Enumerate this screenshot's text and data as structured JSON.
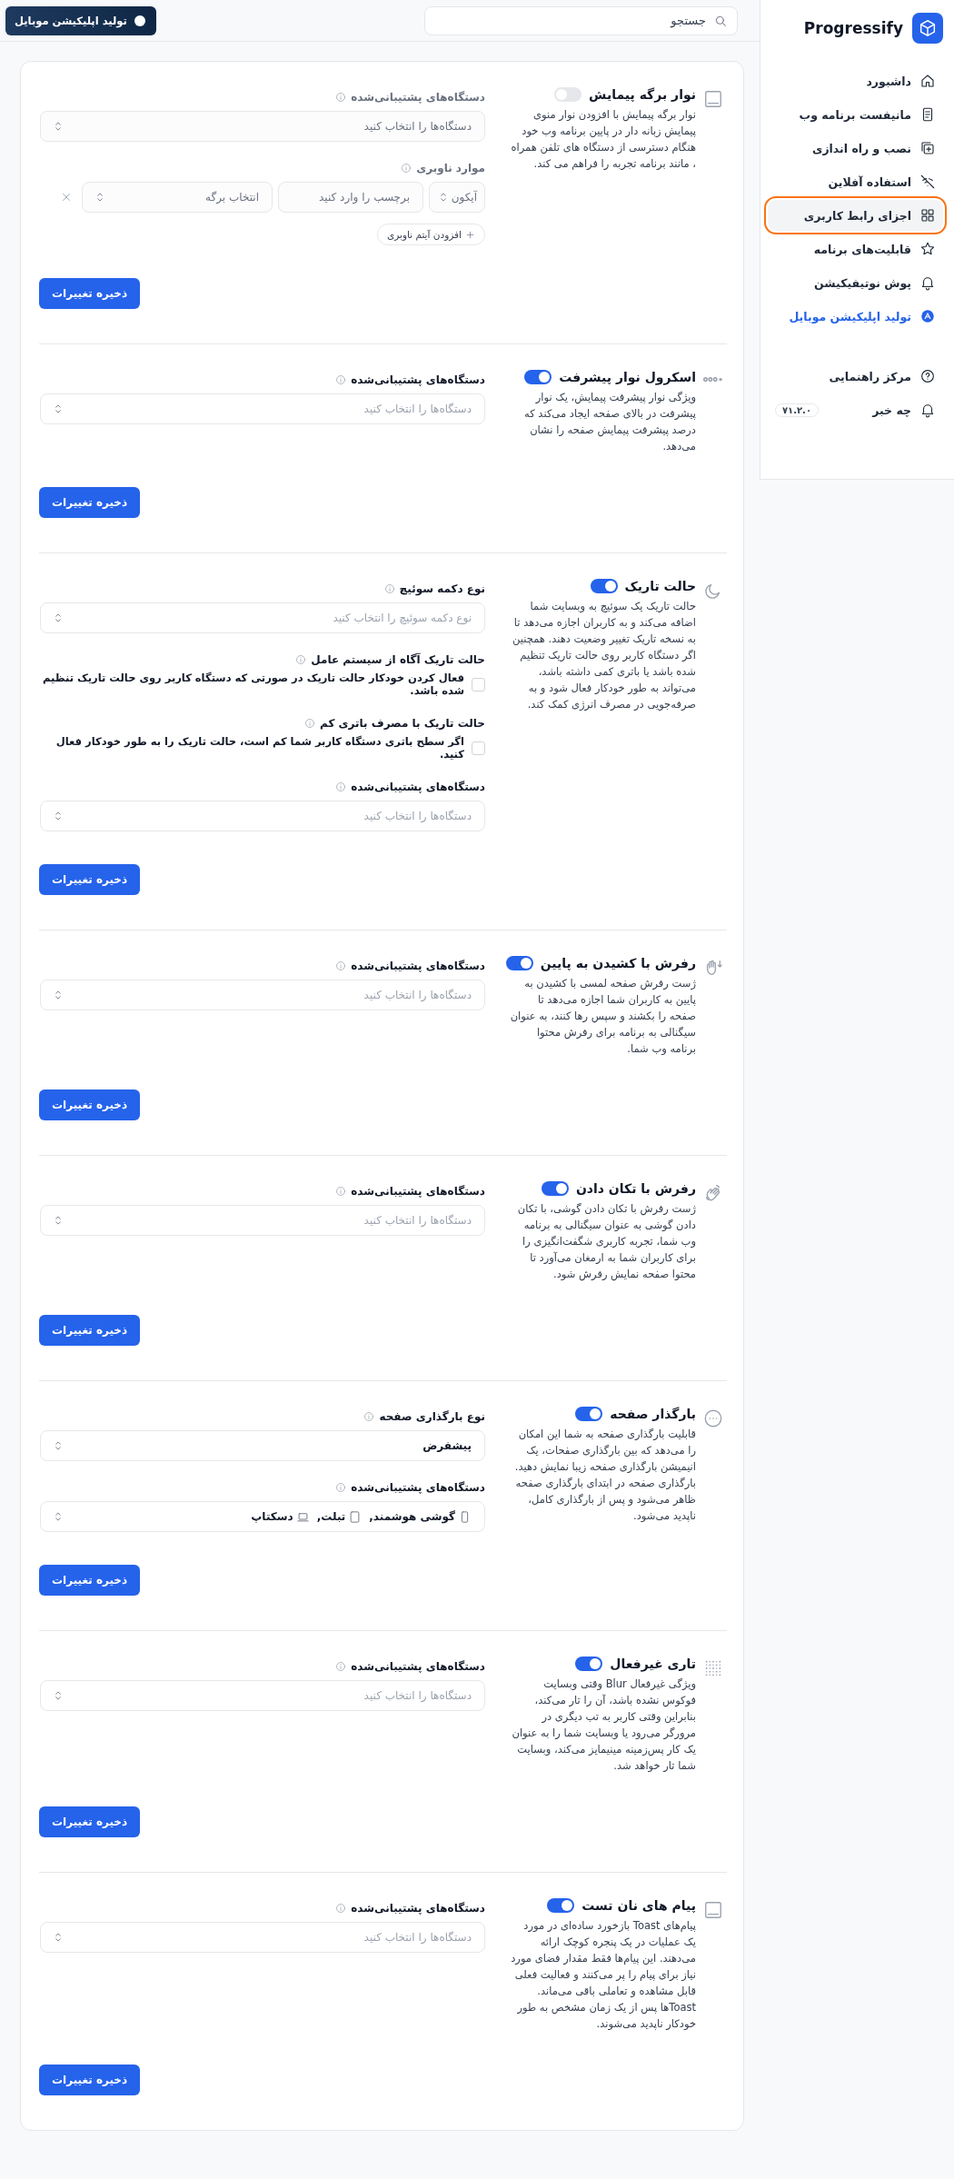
{
  "sidebar": {
    "brand": "Progressify",
    "items": [
      {
        "label": "داشبورد",
        "selected": false,
        "accent": false
      },
      {
        "label": "مانیفست برنامه وب",
        "selected": false,
        "accent": false
      },
      {
        "label": "نصب و راه اندازی",
        "selected": false,
        "accent": false
      },
      {
        "label": "استفاده آفلاین",
        "selected": false,
        "accent": false
      },
      {
        "label": "اجزای رابط کاربری",
        "selected": true,
        "accent": false
      },
      {
        "label": "قابلیت‌های برنامه",
        "selected": false,
        "accent": false
      },
      {
        "label": "پوش نوتیفیکیشن",
        "selected": false,
        "accent": false
      },
      {
        "label": "تولید اپلیکیشن موبایل",
        "selected": false,
        "accent": true
      }
    ],
    "footer": [
      {
        "label": "مرکز راهنمایی"
      },
      {
        "label": "چه خبر",
        "badge": "۷۱.۲.۰"
      }
    ]
  },
  "topbar": {
    "search": {
      "placeholder": "جستجو"
    },
    "button": "تولید اپلیکیشن موبایل"
  },
  "sections": [
    {
      "title": "نوار برگه پیمایش",
      "on": false,
      "description": "نوار برگه پیمایش با افزودن نوار منوی پیمایش زبانه دار در پایین برنامه وب خود هنگام دسترسی از دستگاه های تلفن همراه ، مانند برنامه تجربه را فراهم می کند.",
      "fields": [
        {
          "kind": "select",
          "label": "دستگاه‌های پشتیبانی‌شده",
          "placeholder": "دستگاه‌ها را انتخاب کنید"
        },
        {
          "kind": "nav_items",
          "label": "موارد ناوبری",
          "icon_select": "آیکون",
          "label_input": "برچسب را وارد کنید",
          "page_select": "انتخاب برگه",
          "add": "افزودن آیتم ناوبری"
        }
      ],
      "save": "ذخیره تغییرات"
    },
    {
      "title": "اسکرول نوار پیشرفت",
      "on": true,
      "description": "ویژگی نوار پیشرفت پیمایش، یک نوار پیشرفت در بالای صفحه ایجاد می‌کند که درصد پیشرفت پیمایش صفحه را نشان می‌دهد.",
      "fields": [
        {
          "kind": "select",
          "label": "دستگاه‌های پشتیبانی‌شده",
          "placeholder": "دستگاه‌ها را انتخاب کنید"
        }
      ],
      "save": "ذخیره تغییرات"
    },
    {
      "title": "حالت تاریک",
      "on": true,
      "description": "حالت تاریک یک سوئیچ به وبسایت شما اضافه می‌کند و به کاربران اجازه می‌دهد تا به نسخه تاریک تغییر وضعیت دهند. همچنین اگر دستگاه کاربر روی حالت تاریک تنظیم شده باشد یا باتری کمی داشته باشد، می‌تواند به طور خودکار فعال شود و به صرفه‌جویی در مصرف انرژی کمک کند.",
      "fields": [
        {
          "kind": "select",
          "label": "نوع دکمه سوئیچ",
          "placeholder": "نوع دکمه سوئیچ را انتخاب کنید"
        },
        {
          "kind": "checkbox",
          "label": "حالت تاریک آگاه از سیستم عامل",
          "option": "فعال کردن خودکار حالت تاریک در صورتی که دستگاه کاربر روی حالت تاریک تنظیم شده باشد.",
          "checked": false
        },
        {
          "kind": "checkbox",
          "label": "حالت تاریک با مصرف باتری کم",
          "option": "اگر سطح باتری دستگاه کاربر شما کم است، حالت تاریک را به طور خودکار فعال کنید.",
          "checked": false
        },
        {
          "kind": "select",
          "label": "دستگاه‌های پشتیبانی‌شده",
          "placeholder": "دستگاه‌ها را انتخاب کنید"
        }
      ],
      "save": "ذخیره تغییرات"
    },
    {
      "title": "رفرش با کشیدن به پایین",
      "on": true,
      "description": "ژست رفرش صفحه لمسی با کشیدن به پایین به کاربران شما اجازه می‌دهد تا صفحه را بکشند و سپس رها کنند، به عنوان سیگنالی به برنامه برای رفرش محتوا برنامه وب شما.",
      "fields": [
        {
          "kind": "select",
          "label": "دستگاه‌های پشتیبانی‌شده",
          "placeholder": "دستگاه‌ها را انتخاب کنید"
        }
      ],
      "save": "ذخیره تغییرات"
    },
    {
      "title": "رفرش با تکان دادن",
      "on": true,
      "description": "ژست رفرش با تکان دادن گوشی، با تکان دادن گوشی به عنوان سیگنالی به برنامه وب شما، تجربه کاربری شگفت‌انگیزی را برای کاربران شما به ارمغان می‌آورد تا محتوا صفحه نمایش رفرش شود.",
      "fields": [
        {
          "kind": "select",
          "label": "دستگاه‌های پشتیبانی‌شده",
          "placeholder": "دستگاه‌ها را انتخاب کنید"
        }
      ],
      "save": "ذخیره تغییرات"
    },
    {
      "title": "بارگذار صفحه",
      "on": true,
      "description": "قابلیت بارگذاری صفحه به شما این امکان را می‌دهد که بین بارگذاری صفحات، یک انیمیشن بارگذاری صفحه زیبا نمایش دهید. بارگذاری صفحه در ابتدای بارگذاری صفحه ظاهر می‌شود و پس از بارگذاری کامل، ناپدید می‌شود.",
      "fields": [
        {
          "kind": "select",
          "label": "نوع بارگذاری صفحه",
          "value": "پیشفرض"
        },
        {
          "kind": "devices",
          "label": "دستگاه‌های پشتیبانی‌شده",
          "values": [
            {
              "kind": "phone",
              "label": "گوشی هوشمند,"
            },
            {
              "kind": "tablet",
              "label": "تبلت,"
            },
            {
              "kind": "laptop",
              "label": "دسکتاپ"
            }
          ]
        }
      ],
      "save": "ذخیره تغییرات"
    },
    {
      "title": "تاری غیرفعال",
      "on": true,
      "description": "ویژگی غیرفعال Blur وقتی وبسایت فوکوس نشده باشد، آن را تار می‌کند، بنابراین وقتی کاربر به تب دیگری در مرورگر می‌رود یا وبسایت شما را به عنوان یک کار پس‌زمینه مینیمایز می‌کند، وبسایت شما تار خواهد شد.",
      "fields": [
        {
          "kind": "select",
          "label": "دستگاه‌های پشتیبانی‌شده",
          "placeholder": "دستگاه‌ها را انتخاب کنید"
        }
      ],
      "save": "ذخیره تغییرات"
    },
    {
      "title": "پیام های نان تست",
      "on": true,
      "description": "پیام‌های Toast بازخورد ساده‌ای در مورد یک عملیات در یک پنجره کوچک ارائه می‌دهند. این پیام‌ها فقط مقدار فضای مورد نیاز برای پیام را پر می‌کنند و فعالیت فعلی قابل مشاهده و تعاملی باقی می‌ماند. Toastها پس از یک زمان مشخص به طور خودکار ناپدید می‌شوند.",
      "fields": [
        {
          "kind": "select",
          "label": "دستگاه‌های پشتیبانی‌شده",
          "placeholder": "دستگاه‌ها را انتخاب کنید"
        }
      ],
      "save": "ذخیره تغییرات"
    }
  ]
}
